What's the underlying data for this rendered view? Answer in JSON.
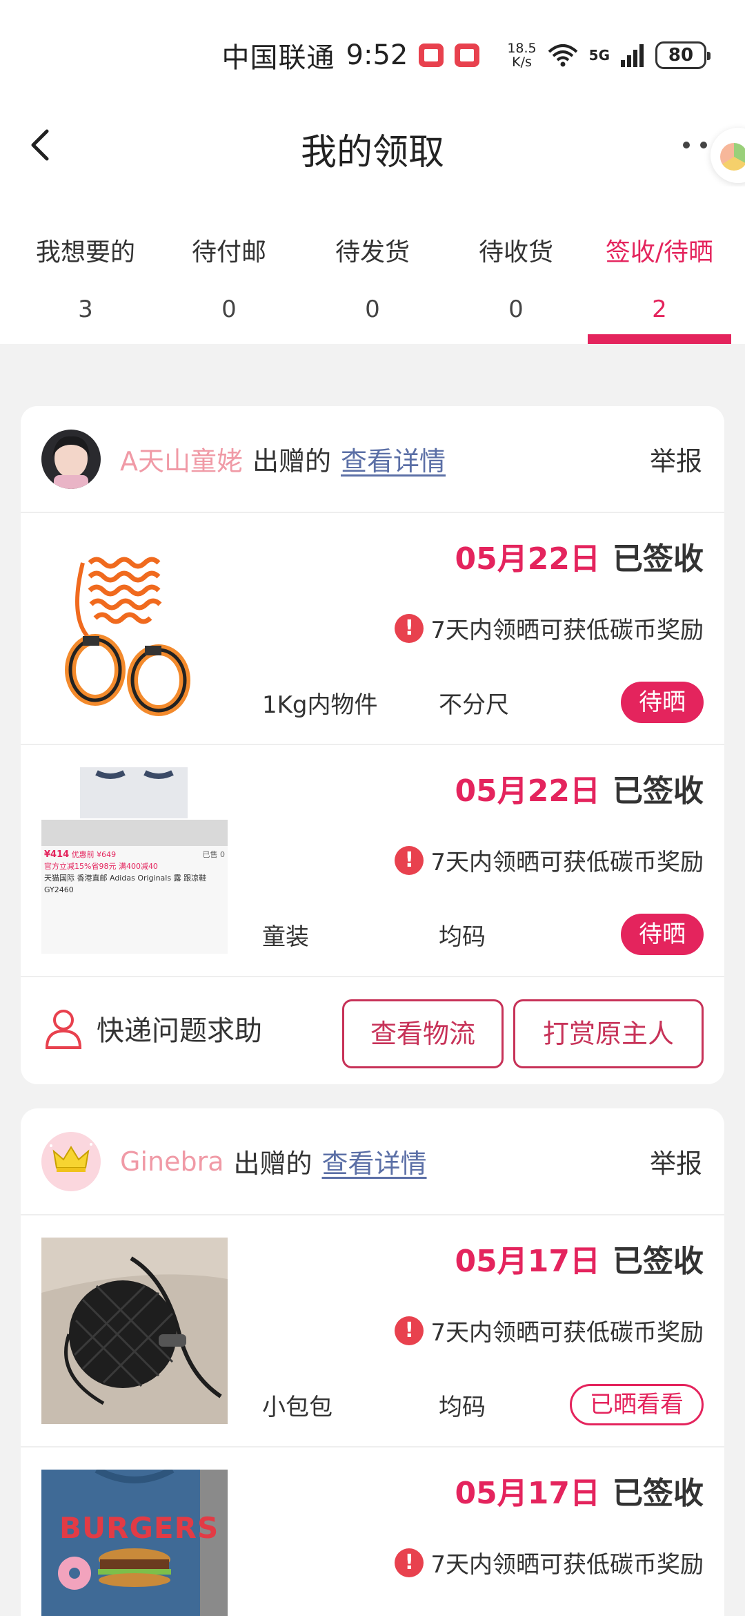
{
  "status_bar": {
    "carrier": "中国联通",
    "time": "9:52",
    "speed_value": "18.5",
    "speed_unit": "K/s",
    "signal": "5G",
    "battery": "80"
  },
  "nav": {
    "title": "我的领取"
  },
  "tabs": [
    {
      "label": "我想要的",
      "count": "3"
    },
    {
      "label": "待付邮",
      "count": "0"
    },
    {
      "label": "待发货",
      "count": "0"
    },
    {
      "label": "待收货",
      "count": "0"
    },
    {
      "label": "签收/待晒",
      "count": "2"
    }
  ],
  "cards": [
    {
      "donor": "A天山童姥",
      "gift_word": "出赠的",
      "detail_link": "查看详情",
      "report": "举报",
      "items": [
        {
          "date": "05月22日",
          "status_text": "已签收",
          "tip": "7天内领晒可获低碳币奖励",
          "category": "1Kg内物件",
          "size": "不分尺",
          "action": "待晒"
        },
        {
          "date": "05月22日",
          "status_text": "已签收",
          "tip": "7天内领晒可获低碳币奖励",
          "category": "童装",
          "size": "均码",
          "action": "待晒"
        }
      ],
      "footer": {
        "help": "快递问题求助",
        "logistics": "查看物流",
        "tip_owner": "打赏原主人"
      }
    },
    {
      "donor": "Ginebra",
      "gift_word": "出赠的",
      "detail_link": "查看详情",
      "report": "举报",
      "items": [
        {
          "date": "05月17日",
          "status_text": "已签收",
          "tip": "7天内领晒可获低碳币奖励",
          "category": "小包包",
          "size": "均码",
          "action": "已晒看看"
        },
        {
          "date": "05月17日",
          "status_text": "已签收",
          "tip": "7天内领晒可获低碳币奖励"
        }
      ]
    }
  ],
  "thumb_text": {
    "price": "¥414",
    "coupon_price": "优惠前 ¥649",
    "product": "天猫国际 香港直邮 Adidas Originals 露 跟凉鞋 GY2460",
    "promo": "官方立减15%省98元 满400减40",
    "sold": "已售 0",
    "shirt": "BURGERS"
  },
  "colors": {
    "accent": "#e4245d",
    "donor_name": "#f09aa6",
    "link": "#5b6fa6",
    "background": "#f2f2f2"
  }
}
